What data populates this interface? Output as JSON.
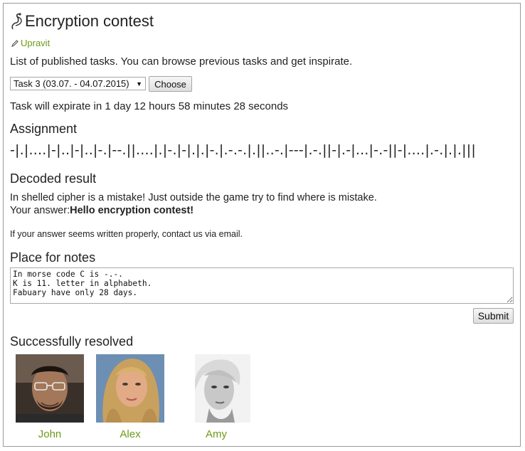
{
  "page": {
    "title": "Encryption contest",
    "edit_label": "Upravit",
    "intro": "List of published tasks. You can browse previous tasks and get inspirate."
  },
  "task_picker": {
    "selected": "Task 3 (03.07. - 04.07.2015)",
    "choose_label": "Choose"
  },
  "countdown": "Task will expirate in 1 day 12 hours 58 minutes 28 seconds",
  "assignment": {
    "heading": "Assignment",
    "cipher": "-|.|....|-|..|-|..|-.|--.||....|.|-.|-|.|.|-.|.-.-.|.||..-.|---|.-.||-|.-|...|-.-||-|....|.-.|.|.|||"
  },
  "decoded": {
    "heading": "Decoded result",
    "message": "In shelled cipher is a mistake! Just outside the game try to find where is mistake.",
    "answer_prefix": "Your answer:",
    "answer": "Hello encryption contest!",
    "contact_note": "If your answer seems written properly, contact us via email."
  },
  "notes": {
    "heading": "Place for notes",
    "value": "In morse code C is -.-.\nK is 11. letter in alphabeth.\nFabuary have only 28 days.",
    "submit_label": "Submit"
  },
  "resolved": {
    "heading": "Successfully resolved",
    "users": [
      {
        "name": "John"
      },
      {
        "name": "Alex"
      },
      {
        "name": "Amy"
      }
    ]
  },
  "colors": {
    "link": "#6e9a16",
    "border": "#9a9a9a"
  },
  "icons": {
    "title": "quill-icon",
    "edit": "pencil-icon"
  }
}
